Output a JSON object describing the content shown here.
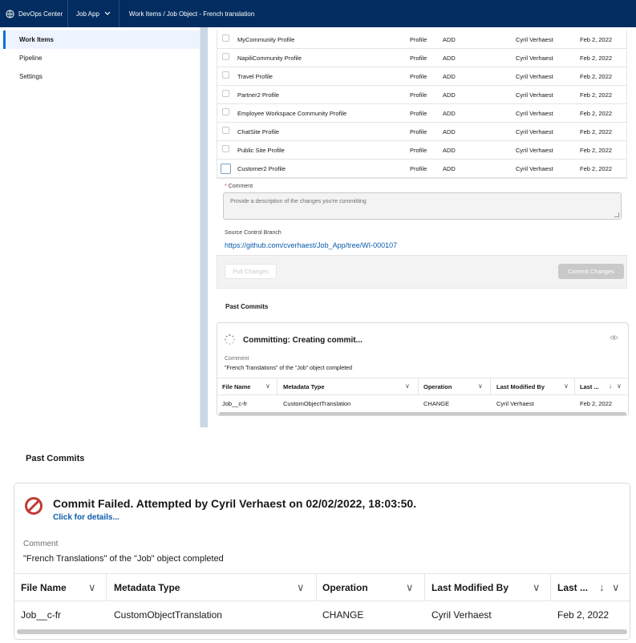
{
  "topbar": {
    "brand": "DevOps Center",
    "app_name": "Job App",
    "breadcrumb": "Work Items / Job Object - French translation"
  },
  "nav": {
    "items": [
      {
        "label": "Work Items",
        "active": true
      },
      {
        "label": "Pipeline",
        "active": false
      },
      {
        "label": "Settings",
        "active": false
      }
    ]
  },
  "files": [
    {
      "name": "MyCommunity Profile",
      "type": "Profile",
      "op": "ADD",
      "by": "Cyril Verhaest",
      "date": "Feb 2, 2022"
    },
    {
      "name": "NapiliCommunity Profile",
      "type": "Profile",
      "op": "ADD",
      "by": "Cyril Verhaest",
      "date": "Feb 2, 2022"
    },
    {
      "name": "Travel Profile",
      "type": "Profile",
      "op": "ADD",
      "by": "Cyril Verhaest",
      "date": "Feb 2, 2022"
    },
    {
      "name": "Partner2 Profile",
      "type": "Profile",
      "op": "ADD",
      "by": "Cyril Verhaest",
      "date": "Feb 2, 2022"
    },
    {
      "name": "Employee Workspace Community Profile",
      "type": "Profile",
      "op": "ADD",
      "by": "Cyril Verhaest",
      "date": "Feb 2, 2022"
    },
    {
      "name": "ChatSite Profile",
      "type": "Profile",
      "op": "ADD",
      "by": "Cyril Verhaest",
      "date": "Feb 2, 2022"
    },
    {
      "name": "Public Site Profile",
      "type": "Profile",
      "op": "ADD",
      "by": "Cyril Verhaest",
      "date": "Feb 2, 2022"
    },
    {
      "name": "Customer2 Profile",
      "type": "Profile",
      "op": "ADD",
      "by": "Cyril Verhaest",
      "date": "Feb 2, 2022"
    }
  ],
  "commit_form": {
    "required_mark": "*",
    "comment_label": "Comment",
    "comment_placeholder": "Provide a description of the changes you're committing",
    "branch_label": "Source Control Branch",
    "branch_url": "https://github.com/cverhaest/Job_App/tree/WI-000107",
    "pull_label": "Pull Changes",
    "commit_label": "Commit Changes"
  },
  "past_commits_top": {
    "title": "Past Commits",
    "status": "Committing: Creating commit...",
    "comment_label": "Comment",
    "comment": "\"French Translations\" of the \"Job\" object completed",
    "columns": [
      "File Name",
      "Metadata Type",
      "Operation",
      "Last Modified By",
      "Last ..."
    ],
    "row": {
      "name": "Job__c-fr",
      "type": "CustomObjectTranslation",
      "op": "CHANGE",
      "by": "Cyril Verhaest",
      "date": "Feb 2, 2022"
    }
  },
  "past_commits_bottom": {
    "title": "Past Commits",
    "status": "Commit Failed. Attempted by Cyril Verhaest on 02/02/2022, 18:03:50.",
    "details_link": "Click for details...",
    "comment_label": "Comment",
    "comment": "\"French Translations\" of the \"Job\" object completed",
    "columns": [
      "File Name",
      "Metadata Type",
      "Operation",
      "Last Modified By",
      "Last ..."
    ],
    "row": {
      "name": "Job__c-fr",
      "type": "CustomObjectTranslation",
      "op": "CHANGE",
      "by": "Cyril Verhaest",
      "date": "Feb 2, 2022"
    }
  },
  "colors": {
    "header_bg": "#032d60",
    "link": "#0b5cab",
    "error": "#c23934",
    "active_nav": "#eef4ff"
  }
}
